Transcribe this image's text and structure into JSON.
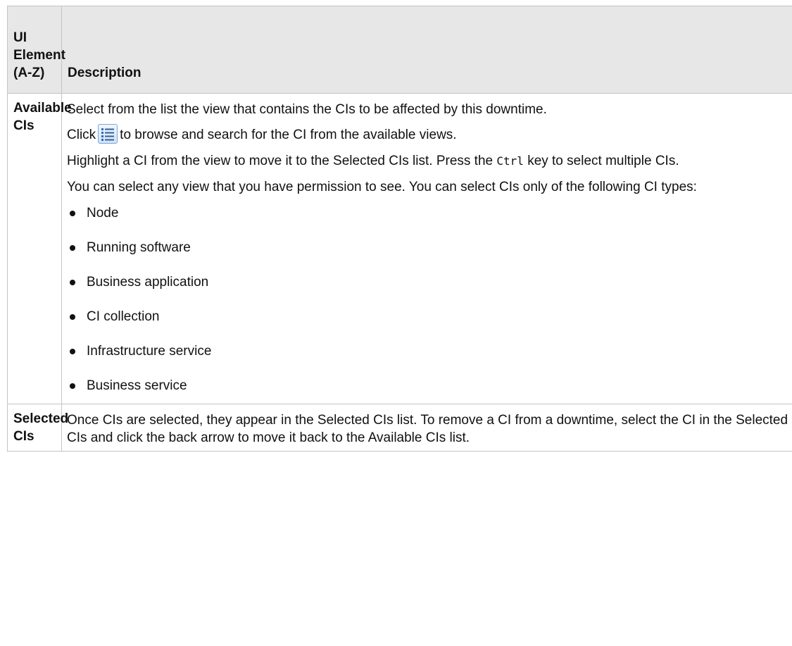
{
  "table": {
    "header": {
      "element_col": [
        "UI",
        "Element",
        "(A-Z)"
      ],
      "description_col": "Description"
    },
    "rows": [
      {
        "element": [
          "Available",
          "CIs"
        ],
        "paragraphs": {
          "p1": "Select from the list the view that contains the CIs to be affected by this downtime.",
          "p2_before": "Click",
          "p2_icon": "list-view-icon",
          "p2_after": "to browse and search for the CI from the available views.",
          "p3_before": "Highlight a CI from the view to move it to the Selected CIs list. Press the",
          "p3_code": "Ctrl",
          "p3_after": "key to select multiple CIs.",
          "p4": "You can select any view that you have permission to see. You can select CIs only of the following CI types:"
        },
        "ci_types": [
          "Node",
          "Running software",
          "Business application",
          "CI collection",
          "Infrastructure service",
          "Business service"
        ]
      },
      {
        "element": [
          "Selected",
          "CIs"
        ],
        "description": "Once CIs are selected, they appear in the Selected CIs list. To remove a CI from a downtime, select the CI in the Selected CIs and click the back arrow to move it back to the Available CIs list."
      }
    ]
  }
}
